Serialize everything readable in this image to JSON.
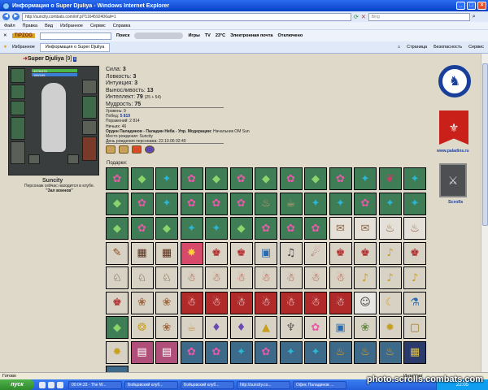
{
  "window": {
    "title": "Информация о Super Djuliya - Windows Internet Explorer"
  },
  "address_bar": {
    "url": "http://suncity.combats.com/inf.pl?1164592406ali=1",
    "search_placeholder": "Bing"
  },
  "menu": [
    "Файл",
    "Правка",
    "Вид",
    "Избранное",
    "Сервис",
    "Справка"
  ],
  "toolbar": {
    "logo": "TIPZOG",
    "search_button": "Поиск",
    "games": "Игры",
    "tv": "TV",
    "temperature": "23°C",
    "email": "Электронная почта",
    "status": "Отключено"
  },
  "tabs": {
    "favorites": "Избранное",
    "active_tab": "Информация о Super Djuliya",
    "page_menu": "Страница",
    "safety_menu": "Безопасность",
    "tools_menu": "Сервис"
  },
  "character": {
    "name": "Super Djuliya",
    "level": "[9]",
    "info_icon": "i",
    "hp": "4478/478",
    "mana": "166/166",
    "city": "Suncity",
    "location_text": "Персонаж сейчас находится в клубе.",
    "location_room": "\"Зал воинов\""
  },
  "stats": [
    {
      "label": "Сила:",
      "value": "3",
      "bonus": ""
    },
    {
      "label": "Ловкость:",
      "value": "3",
      "bonus": ""
    },
    {
      "label": "Интуиция:",
      "value": "3",
      "bonus": ""
    },
    {
      "label": "Выносливость:",
      "value": "13",
      "bonus": ""
    },
    {
      "label": "Интеллект:",
      "value": "79",
      "bonus": "(25 + 54)"
    },
    {
      "label": "Мудрость:",
      "value": "75",
      "bonus": ""
    }
  ],
  "details": {
    "level_line": "Уровень: 9",
    "wins_label": "Побед:",
    "wins": "5 819",
    "losses": "Поражений: 2 814",
    "draws": "Ничьих: 46",
    "order": "Орден Паладинов - Паладин Неба - Упр. Модерации:",
    "order_rank": "Начальник ОМ Sun",
    "birthplace": "Место рождения: Suncity",
    "birthday": "День рождения персонажа: 22.10.06 02:40"
  },
  "gifts": {
    "label": "Подарки:",
    "items": [
      {
        "glyph": "✿",
        "bg": "#3e7d56",
        "fg": "#e65aa8",
        "name": "pink-flower-gift"
      },
      {
        "glyph": "◆",
        "bg": "#3e7d56",
        "fg": "#8ad56b",
        "name": "green-gem-gift"
      },
      {
        "glyph": "✦",
        "bg": "#3e7d56",
        "fg": "#2bb6d8",
        "name": "blue-star-gift"
      },
      {
        "glyph": "✿",
        "bg": "#3e7d56",
        "fg": "#e65aa8",
        "name": "pink-flower-gift"
      },
      {
        "glyph": "◆",
        "bg": "#3e7d56",
        "fg": "#8ad56b",
        "name": "green-gem-gift"
      },
      {
        "glyph": "✿",
        "bg": "#3e7d56",
        "fg": "#e65aa8",
        "name": "pink-flower-gift"
      },
      {
        "glyph": "◆",
        "bg": "#3e7d56",
        "fg": "#8ad56b",
        "name": "green-gem-gift"
      },
      {
        "glyph": "✿",
        "bg": "#3e7d56",
        "fg": "#e65aa8",
        "name": "pink-flower-gift"
      },
      {
        "glyph": "◆",
        "bg": "#3e7d56",
        "fg": "#8ad56b",
        "name": "green-gem-gift"
      },
      {
        "glyph": "✿",
        "bg": "#3e7d56",
        "fg": "#e65aa8",
        "name": "pink-flower-gift"
      },
      {
        "glyph": "✦",
        "bg": "#3e7d56",
        "fg": "#2bb6d8",
        "name": "blue-star-gift"
      },
      {
        "glyph": "❦",
        "bg": "#3e7d56",
        "fg": "#d23a6a",
        "name": "rose-gift"
      },
      {
        "glyph": "✦",
        "bg": "#3e7d56",
        "fg": "#2bb6d8",
        "name": "blue-star-gift"
      },
      {
        "glyph": "◆",
        "bg": "#3e7d56",
        "fg": "#8ad56b",
        "name": "green-gem-gift"
      },
      {
        "glyph": "✿",
        "bg": "#3e7d56",
        "fg": "#e65aa8",
        "name": "pink-flower-gift"
      },
      {
        "glyph": "✦",
        "bg": "#3e7d56",
        "fg": "#2bb6d8",
        "name": "blue-star-gift"
      },
      {
        "glyph": "✿",
        "bg": "#3e7d56",
        "fg": "#e65aa8",
        "name": "pink-flower-gift"
      },
      {
        "glyph": "✿",
        "bg": "#3e7d56",
        "fg": "#e65aa8",
        "name": "pink-flower-gift"
      },
      {
        "glyph": "✿",
        "bg": "#3e7d56",
        "fg": "#e65aa8",
        "name": "pink-flower-gift"
      },
      {
        "glyph": "♨",
        "bg": "#3e7d56",
        "fg": "#c8a070",
        "name": "tea-gift"
      },
      {
        "glyph": "☕",
        "bg": "#3e7d56",
        "fg": "#c8a070",
        "name": "coffee-gift"
      },
      {
        "glyph": "✦",
        "bg": "#3e7d56",
        "fg": "#2bb6d8",
        "name": "blue-star-gift"
      },
      {
        "glyph": "✦",
        "bg": "#3e7d56",
        "fg": "#2bb6d8",
        "name": "blue-star-gift"
      },
      {
        "glyph": "✿",
        "bg": "#3e7d56",
        "fg": "#e65aa8",
        "name": "pink-flower-gift"
      },
      {
        "glyph": "✦",
        "bg": "#3e7d56",
        "fg": "#2bb6d8",
        "name": "blue-star-gift"
      },
      {
        "glyph": "✦",
        "bg": "#3e7d56",
        "fg": "#2bb6d8",
        "name": "blue-star-gift"
      },
      {
        "glyph": "◆",
        "bg": "#3e7d56",
        "fg": "#8ad56b",
        "name": "green-gem-gift"
      },
      {
        "glyph": "✿",
        "bg": "#3e7d56",
        "fg": "#e65aa8",
        "name": "pink-flower-gift"
      },
      {
        "glyph": "◆",
        "bg": "#3e7d56",
        "fg": "#8ad56b",
        "name": "green-gem-gift"
      },
      {
        "glyph": "✦",
        "bg": "#3e7d56",
        "fg": "#2bb6d8",
        "name": "blue-star-gift"
      },
      {
        "glyph": "✦",
        "bg": "#3e7d56",
        "fg": "#2bb6d8",
        "name": "blue-star-gift"
      },
      {
        "glyph": "◆",
        "bg": "#3e7d56",
        "fg": "#8ad56b",
        "name": "green-gem-gift"
      },
      {
        "glyph": "✿",
        "bg": "#3e7d56",
        "fg": "#e65aa8",
        "name": "pink-flower-gift"
      },
      {
        "glyph": "✿",
        "bg": "#3e7d56",
        "fg": "#e65aa8",
        "name": "pink-flower-gift"
      },
      {
        "glyph": "✿",
        "bg": "#3e7d56",
        "fg": "#e65aa8",
        "name": "pink-flower-gift"
      },
      {
        "glyph": "✉",
        "bg": "#e4e0d8",
        "fg": "#8a6a4a",
        "name": "letter-gift"
      },
      {
        "glyph": "✉",
        "bg": "#e4e0d8",
        "fg": "#8a6a4a",
        "name": "letter-gift"
      },
      {
        "glyph": "♨",
        "bg": "#e4e0d8",
        "fg": "#8a5a3a",
        "name": "cake-gift"
      },
      {
        "glyph": "♨",
        "bg": "#e4e0d8",
        "fg": "#8a5a3a",
        "name": "cake-gift"
      },
      {
        "glyph": "✎",
        "bg": "#d8d2c4",
        "fg": "#8a4a20",
        "name": "broom-gift"
      },
      {
        "glyph": "▦",
        "bg": "#d8d2c4",
        "fg": "#5a2e18",
        "name": "chocolate-gift"
      },
      {
        "glyph": "▦",
        "bg": "#d8d2c4",
        "fg": "#5a2e18",
        "name": "chocolate-gift"
      },
      {
        "glyph": "✸",
        "bg": "#d84a6a",
        "fg": "#ffd23a",
        "name": "flower-bouquet-gift"
      },
      {
        "glyph": "♚",
        "bg": "#d8d2c4",
        "fg": "#b02a2a",
        "name": "figurine-gift"
      },
      {
        "glyph": "♚",
        "bg": "#d8d2c4",
        "fg": "#b02a2a",
        "name": "figurine-gift"
      },
      {
        "glyph": "▣",
        "bg": "#d8d2c4",
        "fg": "#2a6ab0",
        "name": "gift-box-gift"
      },
      {
        "glyph": "♫",
        "bg": "#d8d2c4",
        "fg": "#444444",
        "name": "music-box-gift"
      },
      {
        "glyph": "☄",
        "bg": "#d8d2c4",
        "fg": "#b02a2a",
        "name": "comet-gift"
      },
      {
        "glyph": "♚",
        "bg": "#d8d2c4",
        "fg": "#b02a2a",
        "name": "figurine-gift"
      },
      {
        "glyph": "♚",
        "bg": "#d8d2c4",
        "fg": "#b02a2a",
        "name": "figurine-gift"
      },
      {
        "glyph": "♪",
        "bg": "#d8d2c4",
        "fg": "#c8a020",
        "name": "bell-gift"
      },
      {
        "glyph": "♚",
        "bg": "#d8d2c4",
        "fg": "#b02a2a",
        "name": "figurine-gift"
      },
      {
        "glyph": "♘",
        "bg": "#d8d2c4",
        "fg": "#5a3a20",
        "name": "rocking-horse-gift"
      },
      {
        "glyph": "♘",
        "bg": "#d8d2c4",
        "fg": "#5a3a20",
        "name": "rocking-horse-gift"
      },
      {
        "glyph": "♘",
        "bg": "#d8d2c4",
        "fg": "#5a3a20",
        "name": "rocking-horse-gift"
      },
      {
        "glyph": "☃",
        "bg": "#d8d2c4",
        "fg": "#b0402a",
        "name": "santa-gift"
      },
      {
        "glyph": "☃",
        "bg": "#d8d2c4",
        "fg": "#b0402a",
        "name": "santa-gift"
      },
      {
        "glyph": "☃",
        "bg": "#d8d2c4",
        "fg": "#b0402a",
        "name": "santa-gift"
      },
      {
        "glyph": "☃",
        "bg": "#d8d2c4",
        "fg": "#b0402a",
        "name": "santa-gift"
      },
      {
        "glyph": "☃",
        "bg": "#d8d2c4",
        "fg": "#b0402a",
        "name": "santa-gift"
      },
      {
        "glyph": "☃",
        "bg": "#d8d2c4",
        "fg": "#b0402a",
        "name": "santa-gift"
      },
      {
        "glyph": "☃",
        "bg": "#d8d2c4",
        "fg": "#b0402a",
        "name": "santa-gift"
      },
      {
        "glyph": "♪",
        "bg": "#d8d2c4",
        "fg": "#c8a020",
        "name": "bell-gift"
      },
      {
        "glyph": "♪",
        "bg": "#d8d2c4",
        "fg": "#c8a020",
        "name": "bell-gift"
      },
      {
        "glyph": "♪",
        "bg": "#d8d2c4",
        "fg": "#c8a020",
        "name": "bell-gift"
      },
      {
        "glyph": "♚",
        "bg": "#d8d2c4",
        "fg": "#b02a2a",
        "name": "figurine-gift"
      },
      {
        "glyph": "❀",
        "bg": "#d8d2c4",
        "fg": "#a06a40",
        "name": "teddy-bear-gift"
      },
      {
        "glyph": "❀",
        "bg": "#d8d2c4",
        "fg": "#a06a40",
        "name": "teddy-bear-gift"
      },
      {
        "glyph": "☃",
        "bg": "#b02a2a",
        "fg": "#ffffff",
        "name": "snowman-gift"
      },
      {
        "glyph": "☃",
        "bg": "#b02a2a",
        "fg": "#ffffff",
        "name": "snowman-gift"
      },
      {
        "glyph": "☃",
        "bg": "#b02a2a",
        "fg": "#ffffff",
        "name": "snowman-gift"
      },
      {
        "glyph": "☃",
        "bg": "#b02a2a",
        "fg": "#ffffff",
        "name": "snowman-gift"
      },
      {
        "glyph": "☃",
        "bg": "#b02a2a",
        "fg": "#ffffff",
        "name": "snowman-gift"
      },
      {
        "glyph": "☃",
        "bg": "#b02a2a",
        "fg": "#ffffff",
        "name": "snowman-gift"
      },
      {
        "glyph": "☃",
        "bg": "#b02a2a",
        "fg": "#ffffff",
        "name": "snowman-gift"
      },
      {
        "glyph": "☺",
        "bg": "#e8e6e2",
        "fg": "#444444",
        "name": "mask-gift"
      },
      {
        "glyph": "☾",
        "bg": "#d8d2c4",
        "fg": "#e0a020",
        "name": "moon-gift"
      },
      {
        "glyph": "⚗",
        "bg": "#d8d2c4",
        "fg": "#2a6ab0",
        "name": "potion-gift"
      },
      {
        "glyph": "◆",
        "bg": "#3e7d56",
        "fg": "#8ad56b",
        "name": "green-gem-gift"
      },
      {
        "glyph": "❂",
        "bg": "#d8d2c4",
        "fg": "#c8a020",
        "name": "necklace-gift"
      },
      {
        "glyph": "❀",
        "bg": "#d8d2c4",
        "fg": "#a06a40",
        "name": "teddy-bear-gift"
      },
      {
        "glyph": "☕",
        "bg": "#d8d2c4",
        "fg": "#c89a5a",
        "name": "tea-cup-gift"
      },
      {
        "glyph": "♦",
        "bg": "#d8d2c4",
        "fg": "#6a4ab0",
        "name": "purple-gem-gift"
      },
      {
        "glyph": "♦",
        "bg": "#d8d2c4",
        "fg": "#6a4ab0",
        "name": "purple-gem-gift"
      },
      {
        "glyph": "▲",
        "bg": "#d8d2c4",
        "fg": "#c8a020",
        "name": "gold-bar-gift"
      },
      {
        "glyph": "♆",
        "bg": "#d8d2c4",
        "fg": "#5a5a5a",
        "name": "fork-gift"
      },
      {
        "glyph": "✿",
        "bg": "#d8d2c4",
        "fg": "#e65aa8",
        "name": "flower-gift"
      },
      {
        "glyph": "▣",
        "bg": "#d8d2c4",
        "fg": "#2a6ab0",
        "name": "gift-box-gift"
      },
      {
        "glyph": "❀",
        "bg": "#d8d2c4",
        "fg": "#6a8a4a",
        "name": "bouquet-gift"
      },
      {
        "glyph": "✹",
        "bg": "#d8d2c4",
        "fg": "#c8a020",
        "name": "gold-medal-gift"
      },
      {
        "glyph": "▢",
        "bg": "#d8d2c4",
        "fg": "#a07a30",
        "name": "golden-frame-gift"
      },
      {
        "glyph": "✹",
        "bg": "#d8d2c4",
        "fg": "#c8a020",
        "name": "gold-medal-gift"
      },
      {
        "glyph": "▤",
        "bg": "#b0507a",
        "fg": "#ffffff",
        "name": "book-gift"
      },
      {
        "glyph": "▤",
        "bg": "#b0507a",
        "fg": "#ffffff",
        "name": "book-gift"
      },
      {
        "glyph": "✿",
        "bg": "#3e6a8a",
        "fg": "#e65aa8",
        "name": "pink-flower-gift"
      },
      {
        "glyph": "✿",
        "bg": "#3e6a8a",
        "fg": "#e65aa8",
        "name": "pink-flower-gift"
      },
      {
        "glyph": "✦",
        "bg": "#3e6a8a",
        "fg": "#2bb6d8",
        "name": "blue-star-gift"
      },
      {
        "glyph": "✿",
        "bg": "#3e6a8a",
        "fg": "#e65aa8",
        "name": "pink-flower-gift"
      },
      {
        "glyph": "✦",
        "bg": "#3e6a8a",
        "fg": "#2bb6d8",
        "name": "blue-star-gift"
      },
      {
        "glyph": "✦",
        "bg": "#3e6a8a",
        "fg": "#2bb6d8",
        "name": "blue-star-gift"
      },
      {
        "glyph": "♨",
        "bg": "#3e6a8a",
        "fg": "#e0a020",
        "name": "candle-gift"
      },
      {
        "glyph": "♨",
        "bg": "#3e6a8a",
        "fg": "#e0a020",
        "name": "candle-gift"
      },
      {
        "glyph": "♨",
        "bg": "#3e6a8a",
        "fg": "#e0a020",
        "name": "candle-gift"
      },
      {
        "glyph": "▦",
        "bg": "#2a3a6a",
        "fg": "#e0c040",
        "name": "tapestry-gift"
      },
      {
        "glyph": "♜",
        "bg": "#3e6a8a",
        "fg": "#cfcfcf",
        "name": "tower-gift"
      }
    ]
  },
  "sidebar": {
    "paladins_link": "www.paladins.ru",
    "scrolls_link": "Scrolls"
  },
  "statusbar": {
    "left": "Готово",
    "zone": "Интернет"
  },
  "taskbar": {
    "start": "пуск",
    "tasks": [
      "00:04:33 - The W...",
      "Бойцовский клуб...",
      "Бойцовский клуб...",
      "http://suncity.co...",
      "Офис Паладинов ..."
    ],
    "clock": "22:05"
  },
  "watermark": "photo.scrolls.combats.com",
  "colors": {
    "page_bg": "#ded9c9",
    "link_blue": "#1a3fa0",
    "title_bar": "#0841c8"
  }
}
